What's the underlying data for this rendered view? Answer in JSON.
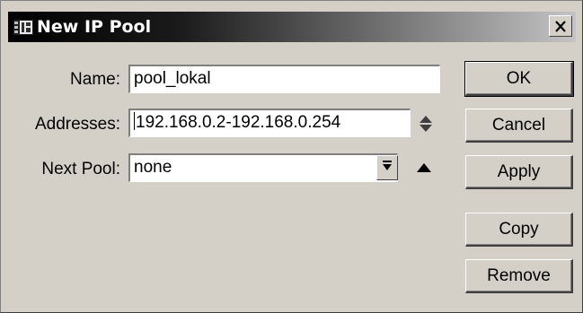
{
  "window": {
    "title": "New IP Pool",
    "icon": "mikrotik-app-icon",
    "close_icon": "close-icon"
  },
  "form": {
    "name": {
      "label": "Name:",
      "value": "pool_lokal"
    },
    "addresses": {
      "label": "Addresses:",
      "value": "192.168.0.2-192.168.0.254",
      "spinner_icon": "up-down-arrows-icon"
    },
    "next_pool": {
      "label": "Next Pool:",
      "value": "none",
      "dropdown_icon": "dropdown-arrow-icon",
      "collapse_icon": "triangle-up-icon"
    }
  },
  "buttons": {
    "ok": "OK",
    "cancel": "Cancel",
    "apply": "Apply",
    "copy": "Copy",
    "remove": "Remove"
  },
  "colors": {
    "dialog_bg": "#d4d0c8",
    "title_start": "#000000",
    "title_end": "#c4c4c4"
  }
}
